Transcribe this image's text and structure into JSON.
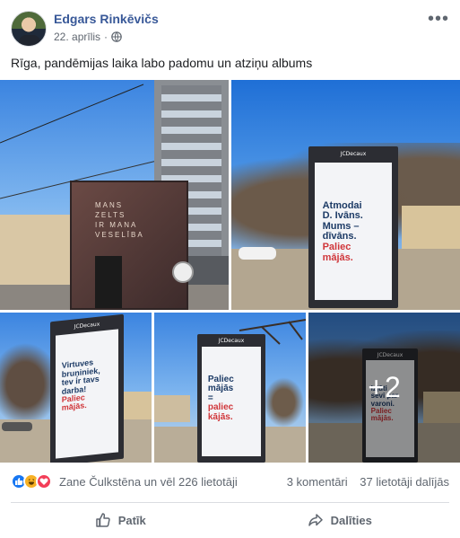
{
  "post": {
    "author": "Edgars Rinkēvičs",
    "date": "22. aprīlis",
    "separator": "·",
    "more_icon": "more-options-icon",
    "caption": "Rīga, pandēmijas laika labo padomu un atziņu albums"
  },
  "photos": {
    "p1": {
      "kiosk_text": [
        "MANS",
        "ZELTS",
        "IR MANA",
        "VESELĪBA"
      ]
    },
    "p2": {
      "brand": "JCDecaux",
      "lines_dark": [
        "Atmodai",
        "D. Ivāns.",
        "Mums –",
        "dīvāns."
      ],
      "lines_red": [
        "Paliec",
        "mājās."
      ]
    },
    "p3": {
      "brand": "JCDecaux",
      "lines_dark": [
        "Virtuves",
        "bruņiniek,",
        "tev ir tavs",
        "darba!"
      ],
      "lines_red": [
        "Paliec",
        "mājās."
      ]
    },
    "p4": {
      "brand": "JCDecaux",
      "lines_dark": [
        "Paliec",
        "mājās",
        "="
      ],
      "lines_red": [
        "paliec",
        "kājās."
      ]
    },
    "p5": {
      "brand": "JCDecaux",
      "lines_dark": [
        "Izjūti",
        "sevi par",
        "varoni."
      ],
      "lines_red": [
        "Paliec",
        "mājās."
      ],
      "more_count": "+2"
    }
  },
  "stats": {
    "reaction_icons": [
      "like-icon",
      "haha-icon",
      "love-icon"
    ],
    "reactions_text": "Zane Čulkstēna un vēl 226 lietotāji",
    "comments": "3 komentāri",
    "shares": "37 lietotāji dalījās"
  },
  "actions": {
    "like": "Patīk",
    "share": "Dalīties"
  },
  "colors": {
    "link": "#385898",
    "secondary": "#606770",
    "red_text": "#d0363a",
    "poster_dark": "#1d3b66"
  }
}
